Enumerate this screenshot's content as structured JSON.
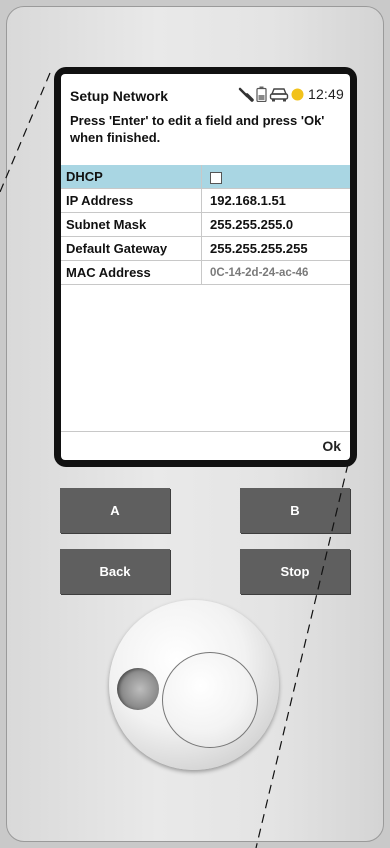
{
  "screen": {
    "title": "Setup Network",
    "clock": "12:49",
    "instruction": "Press 'Enter' to edit a field and press 'Ok' when finished.",
    "status_icons": [
      "wrench-icon",
      "battery-icon",
      "car-icon",
      "sun-icon"
    ],
    "rows": [
      {
        "label": "DHCP",
        "value": "",
        "type": "checkbox",
        "checked": false,
        "selected": true
      },
      {
        "label": "IP Address",
        "value": "192.168.1.51"
      },
      {
        "label": "Subnet Mask",
        "value": "255.255.255.0"
      },
      {
        "label": "Default Gateway",
        "value": "255.255.255.255"
      },
      {
        "label": "MAC Address",
        "value": "0C-14-2d-24-ac-46",
        "readonly": true
      }
    ],
    "softkey_ok": "Ok"
  },
  "buttons": {
    "a": "A",
    "b": "B",
    "back": "Back",
    "stop": "Stop"
  },
  "colors": {
    "selected_row": "#a9d6e3",
    "hardware_button": "#5f5f5f",
    "bezel": "#111111",
    "sun_icon": "#f2c21b"
  }
}
